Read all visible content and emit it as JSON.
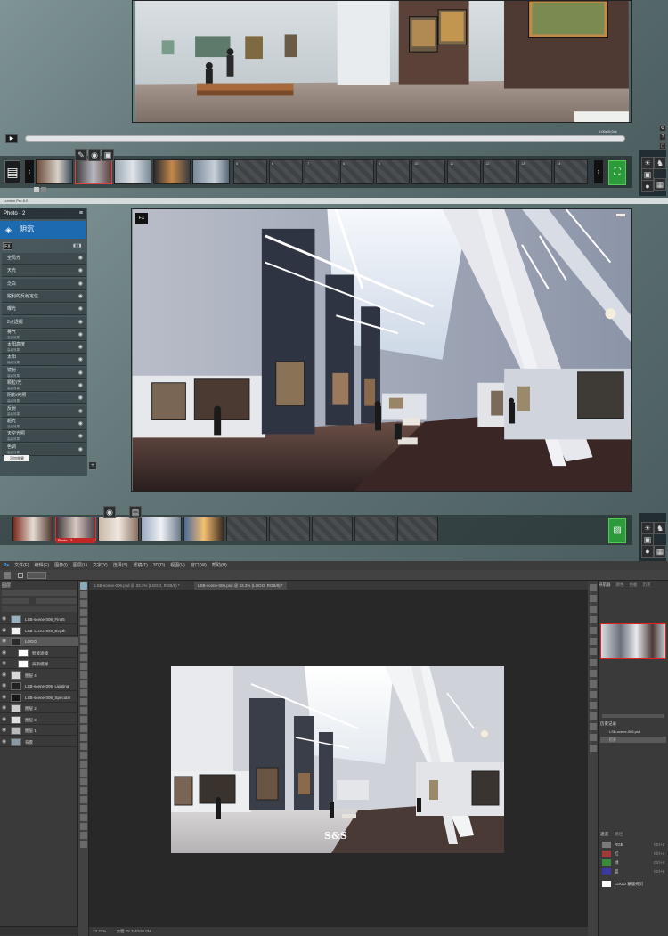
{
  "lumion_top": {
    "time_readout": "0:00s/0:04s",
    "thumbs_count_label": [],
    "tool_icons": [
      "brush-icon",
      "camera-icon",
      "movie-icon"
    ],
    "empty_slots": [
      "5",
      "6",
      "7",
      "8",
      "9",
      "10",
      "11",
      "12",
      "13",
      "14"
    ]
  },
  "lumion_titlebar": "Lumion Pro 8.0",
  "lumion_mid": {
    "photo_title": "Photo - 2",
    "effects_header": "阴沉",
    "fx_badge": "FX",
    "effects": [
      {
        "name": "全局光",
        "sub": ""
      },
      {
        "name": "天光",
        "sub": ""
      },
      {
        "name": "泛白",
        "sub": ""
      },
      {
        "name": "锐利的反射定位",
        "sub": ""
      },
      {
        "name": "曝光",
        "sub": ""
      },
      {
        "name": "2点透视",
        "sub": ""
      },
      {
        "name": "雾气",
        "sub": "高级效果"
      },
      {
        "name": "太阳高度",
        "sub": "高级效果"
      },
      {
        "name": "太阳",
        "sub": "高级效果"
      },
      {
        "name": "镜射",
        "sub": "高级效果"
      },
      {
        "name": "颗粒/光",
        "sub": "高级效果"
      },
      {
        "name": "阴影/光照",
        "sub": "高级效果"
      },
      {
        "name": "反射",
        "sub": "高级效果"
      },
      {
        "name": "超光",
        "sub": "高级效果"
      },
      {
        "name": "天空光照",
        "sub": "高级效果"
      },
      {
        "name": "色调",
        "sub": "高级效果"
      }
    ],
    "tooltip_text": "添加效果",
    "selected_thumb_label": "Photo - 2"
  },
  "ps": {
    "menu": [
      "Ps",
      "文件(F)",
      "编辑(E)",
      "图像(I)",
      "图层(L)",
      "文字(Y)",
      "选择(S)",
      "滤镜(T)",
      "3D(D)",
      "视图(V)",
      "窗口(W)",
      "帮助(H)"
    ],
    "tabs": [
      "LSB-scene-006.psd @ 33.3% (LOGO, RGB/8) *",
      "LSB-scene-006.psd @ 33.3% (LOGO, RGB/8) *"
    ],
    "layers_title": "图层",
    "layers": [
      {
        "name": "LSB-scene-006_Fin05",
        "thumb": "#9ab2c0"
      },
      {
        "name": "LSB-scene-006_Depth",
        "thumb": "#f2f2f2"
      },
      {
        "name": "LOGO",
        "thumb": "#2a2a2a"
      },
      {
        "name": "智能滤镜",
        "thumb": "#ffffff"
      },
      {
        "name": "高斯模糊",
        "thumb": "#ffffff"
      },
      {
        "name": "图层 4",
        "thumb": "#d8d8d8"
      },
      {
        "name": "LSB-scene-006_Lighting",
        "thumb": "#222222"
      },
      {
        "name": "LSB-scene-006_Specular",
        "thumb": "#151515"
      },
      {
        "name": "图层 2",
        "thumb": "#cfcfcf"
      },
      {
        "name": "图层 3",
        "thumb": "#e0e0e0"
      },
      {
        "name": "图层 1",
        "thumb": "#bbbbbb"
      },
      {
        "name": "背景",
        "thumb": "#8a9aa4"
      }
    ],
    "right_tabs": [
      "导航器",
      "颜色",
      "色板",
      "历史"
    ],
    "history_title": "历史记录",
    "history_items": [
      "LSB-scene-006.psd",
      "打开"
    ],
    "channels_tabs": [
      "通道",
      "路径"
    ],
    "channels": [
      {
        "name": "RGB",
        "key": "Ctrl+2",
        "color": "#7a7a7a"
      },
      {
        "name": "红",
        "key": "Ctrl+3",
        "color": "#a03a3a"
      },
      {
        "name": "绿",
        "key": "Ctrl+4",
        "color": "#3a8a3a"
      },
      {
        "name": "蓝",
        "key": "Ctrl+5",
        "color": "#3a3aa0"
      },
      {
        "name": "LOGO 蒙版拷贝",
        "key": "",
        "color": "#ffffff"
      }
    ],
    "zoom": "33.33%",
    "doc_info": "文档:25.7M/530.0M",
    "logo_text": "S&S"
  }
}
